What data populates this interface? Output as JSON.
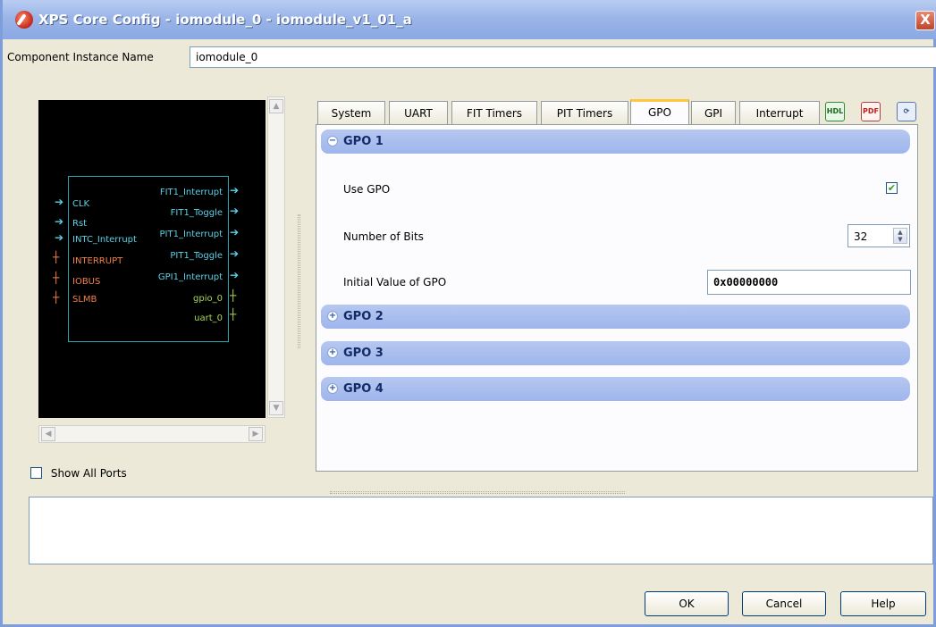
{
  "window": {
    "title": "XPS Core Config - iomodule_0 - iomodule_v1_01_a",
    "close_label": "X"
  },
  "instance": {
    "label": "Component Instance Name",
    "value": "iomodule_0"
  },
  "schematic": {
    "left_pins": [
      {
        "label": "CLK",
        "color": "cyan"
      },
      {
        "label": "Rst",
        "color": "cyan"
      },
      {
        "label": "INTC_Interrupt",
        "color": "cyan"
      },
      {
        "label": "INTERRUPT",
        "color": "orange"
      },
      {
        "label": "IOBUS",
        "color": "orange"
      },
      {
        "label": "SLMB",
        "color": "orange"
      }
    ],
    "right_pins": [
      {
        "label": "FIT1_Interrupt",
        "color": "cyan"
      },
      {
        "label": "FIT1_Toggle",
        "color": "cyan"
      },
      {
        "label": "PIT1_Interrupt",
        "color": "cyan"
      },
      {
        "label": "PIT1_Toggle",
        "color": "cyan"
      },
      {
        "label": "GPI1_Interrupt",
        "color": "cyan"
      },
      {
        "label": "gpio_0",
        "color": "green"
      },
      {
        "label": "uart_0",
        "color": "green"
      }
    ]
  },
  "show_all_ports": {
    "label": "Show All Ports",
    "checked": false
  },
  "tabs": [
    {
      "label": "System",
      "active": false
    },
    {
      "label": "UART",
      "active": false
    },
    {
      "label": "FIT Timers",
      "active": false
    },
    {
      "label": "PIT Timers",
      "active": false
    },
    {
      "label": "GPO",
      "active": true
    },
    {
      "label": "GPI",
      "active": false
    },
    {
      "label": "Interrupt",
      "active": false
    }
  ],
  "toolbar_icons": [
    {
      "name": "hdl-icon",
      "label": "HDL"
    },
    {
      "name": "pdf-icon",
      "label": "PDF"
    },
    {
      "name": "help-icon",
      "label": ""
    }
  ],
  "sections": [
    {
      "label": "GPO 1",
      "expanded": true
    },
    {
      "label": "GPO 2",
      "expanded": false
    },
    {
      "label": "GPO 3",
      "expanded": false
    },
    {
      "label": "GPO 4",
      "expanded": false
    }
  ],
  "gpo1": {
    "use_gpo_label": "Use GPO",
    "use_gpo_checked": true,
    "num_bits_label": "Number of Bits",
    "num_bits_value": "32",
    "init_value_label": "Initial Value of GPO",
    "init_value": "0x00000000"
  },
  "buttons": {
    "ok": "OK",
    "cancel": "Cancel",
    "help": "Help"
  },
  "colors": {
    "title_bar": "#9bb5e8",
    "window_bg": "#ece9d8",
    "section_header": "#a6bbee",
    "active_tab_accent": "#ffc83c",
    "schematic_bg": "#000000",
    "pin_cyan": "#5ad2e8",
    "pin_orange": "#f0824a",
    "pin_green": "#a8d85a"
  }
}
